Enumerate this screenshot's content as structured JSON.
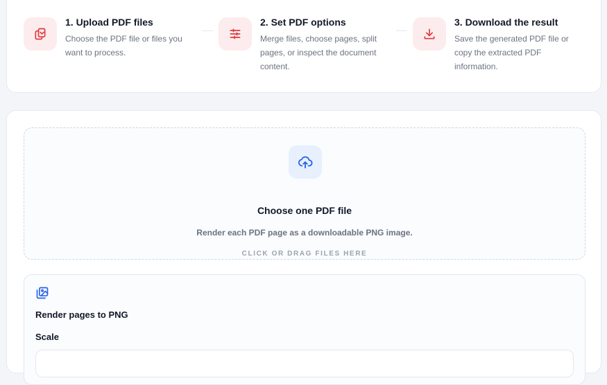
{
  "steps": [
    {
      "title": "1. Upload PDF files",
      "desc_lines": [
        "Choose the PDF file or files you",
        "want to process."
      ],
      "icon": "copy-icon"
    },
    {
      "title": "2. Set PDF options",
      "desc_lines": [
        "Merge files, choose pages, split",
        "pages, or inspect the document",
        "content."
      ],
      "icon": "sliders-icon"
    },
    {
      "title": "3. Download the result",
      "desc_lines": [
        "Save the generated PDF file or",
        "copy the extracted PDF",
        "information."
      ],
      "icon": "download-icon"
    }
  ],
  "dropzone": {
    "icon": "cloud-upload-icon",
    "title": "Choose one PDF file",
    "subtitle": "Render each PDF page as a downloadable PNG image.",
    "cta": "CLICK OR DRAG FILES HERE"
  },
  "options": {
    "icon": "images-icon",
    "title": "Render pages to PNG",
    "scale_label": "Scale"
  },
  "colors": {
    "accent_red": "#e0393e",
    "accent_blue": "#2563eb",
    "step_icon_bg": "#fdeced",
    "drop_icon_bg": "#e8f0fe"
  }
}
